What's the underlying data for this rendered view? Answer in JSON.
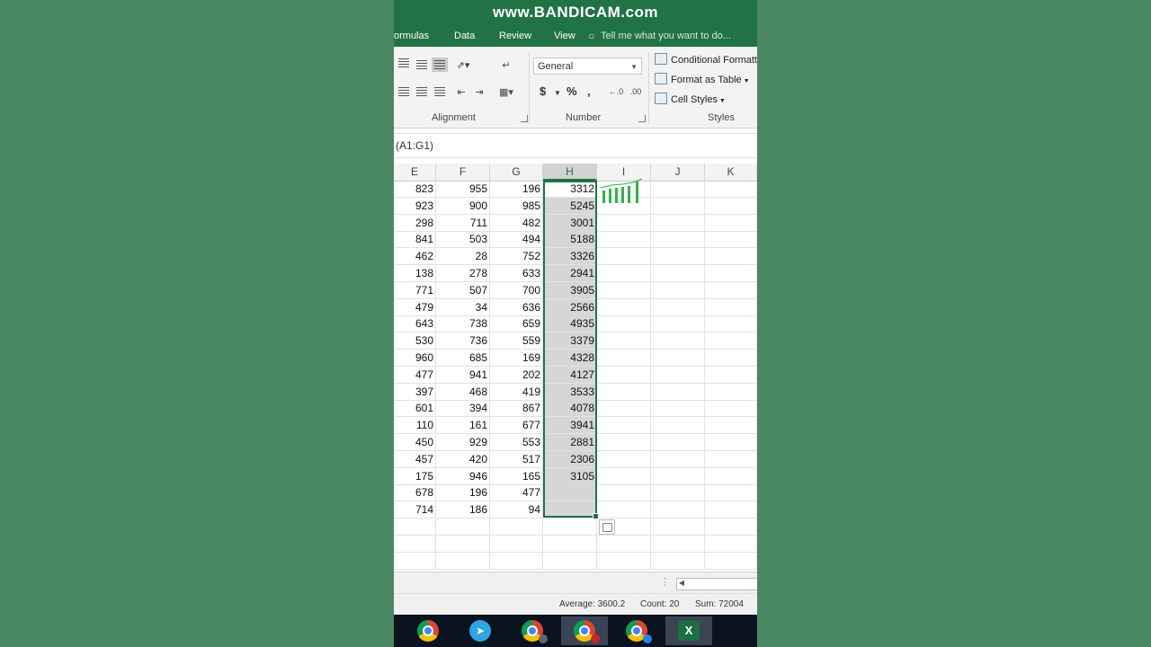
{
  "watermark": "www.BANDICAM.com",
  "tabs": [
    "ormulas",
    "Data",
    "Review",
    "View"
  ],
  "tell_me": "Tell me what you want to do...",
  "ribbon": {
    "alignment_label": "Alignment",
    "number_label": "Number",
    "styles_label": "Styles",
    "number_format": "General",
    "currency_symbol": "$",
    "percent_symbol": "%",
    "comma_symbol": ",",
    "conditional_formatting": "Conditional Formatt",
    "format_as_table": "Format as Table",
    "cell_styles": "Cell Styles"
  },
  "formula_bar": "(A1:G1)",
  "columns": [
    "E",
    "F",
    "G",
    "H",
    "I",
    "J",
    "K"
  ],
  "selected_column": "H",
  "rows": [
    [
      "823",
      "955",
      "196",
      "3312"
    ],
    [
      "923",
      "900",
      "985",
      "5245"
    ],
    [
      "298",
      "711",
      "482",
      "3001"
    ],
    [
      "841",
      "503",
      "494",
      "5188"
    ],
    [
      "462",
      "28",
      "752",
      "3326"
    ],
    [
      "138",
      "278",
      "633",
      "2941"
    ],
    [
      "771",
      "507",
      "700",
      "3905"
    ],
    [
      "479",
      "34",
      "636",
      "2566"
    ],
    [
      "643",
      "738",
      "659",
      "4935"
    ],
    [
      "530",
      "736",
      "559",
      "3379"
    ],
    [
      "960",
      "685",
      "169",
      "4328"
    ],
    [
      "477",
      "941",
      "202",
      "4127"
    ],
    [
      "397",
      "468",
      "419",
      "3533"
    ],
    [
      "601",
      "394",
      "867",
      "4078"
    ],
    [
      "110",
      "161",
      "677",
      "3941"
    ],
    [
      "450",
      "929",
      "553",
      "2881"
    ],
    [
      "457",
      "420",
      "517",
      "2306"
    ],
    [
      "175",
      "946",
      "165",
      "3105"
    ],
    [
      "678",
      "196",
      "477",
      ""
    ],
    [
      "714",
      "186",
      "94",
      ""
    ]
  ],
  "status": {
    "average": "Average: 3600.2",
    "count": "Count: 20",
    "sum": "Sum: 72004"
  },
  "taskbar": [
    "chrome-icon",
    "telegram-icon",
    "chrome-icon",
    "chrome-icon",
    "chrome-icon",
    "excel-icon"
  ],
  "colors": {
    "excel_green": "#217346",
    "background": "#4a8764"
  }
}
